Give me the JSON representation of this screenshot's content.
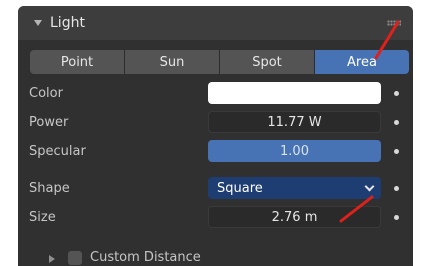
{
  "panel": {
    "title": "Light"
  },
  "light_types": {
    "tabs": [
      {
        "label": "Point",
        "active": false
      },
      {
        "label": "Sun",
        "active": false
      },
      {
        "label": "Spot",
        "active": false
      },
      {
        "label": "Area",
        "active": true
      }
    ]
  },
  "properties": {
    "color": {
      "label": "Color",
      "value": "#ffffff"
    },
    "power": {
      "label": "Power",
      "value": "11.77 W"
    },
    "specular": {
      "label": "Specular",
      "value": "1.00",
      "fill": 1.0
    },
    "shape": {
      "label": "Shape",
      "value": "Square"
    },
    "size": {
      "label": "Size",
      "value": "2.76 m"
    }
  },
  "custom_distance": {
    "label": "Custom Distance",
    "checked": false
  },
  "colors": {
    "accent": "#4772b3",
    "annotation": "#e0201b"
  }
}
